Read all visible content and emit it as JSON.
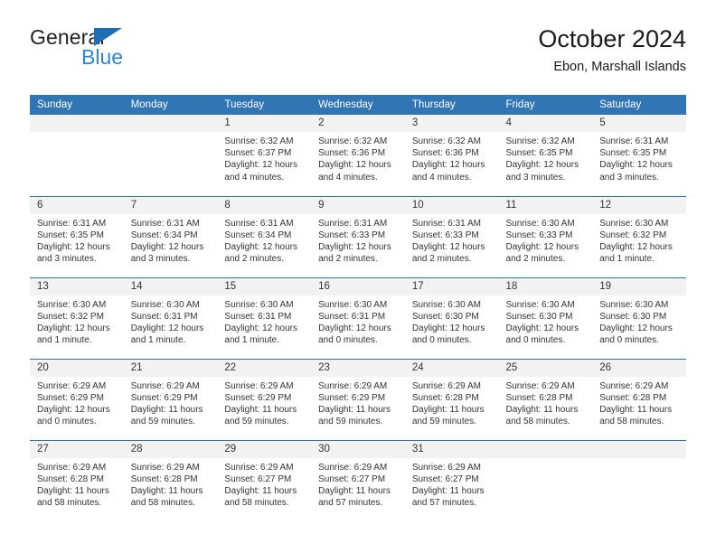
{
  "brand": {
    "word_one": "General",
    "word_two": "Blue",
    "triangle_color": "#1d6eb4",
    "blue_text_color": "#2f86d6"
  },
  "header": {
    "title": "October 2024",
    "subtitle": "Ebon, Marshall Islands"
  },
  "theme": {
    "header_blue": "#3175b4",
    "daynum_band": "#f2f2f2",
    "text": "#333333"
  },
  "weekdays": [
    "Sunday",
    "Monday",
    "Tuesday",
    "Wednesday",
    "Thursday",
    "Friday",
    "Saturday"
  ],
  "labels": {
    "sunrise": "Sunrise:",
    "sunset": "Sunset:",
    "daylight": "Daylight:"
  },
  "weeks": [
    [
      {
        "day": ""
      },
      {
        "day": ""
      },
      {
        "day": "1",
        "sunrise": "Sunrise: 6:32 AM",
        "sunset": "Sunset: 6:37 PM",
        "daylight_1": "Daylight: 12 hours",
        "daylight_2": "and 4 minutes."
      },
      {
        "day": "2",
        "sunrise": "Sunrise: 6:32 AM",
        "sunset": "Sunset: 6:36 PM",
        "daylight_1": "Daylight: 12 hours",
        "daylight_2": "and 4 minutes."
      },
      {
        "day": "3",
        "sunrise": "Sunrise: 6:32 AM",
        "sunset": "Sunset: 6:36 PM",
        "daylight_1": "Daylight: 12 hours",
        "daylight_2": "and 4 minutes."
      },
      {
        "day": "4",
        "sunrise": "Sunrise: 6:32 AM",
        "sunset": "Sunset: 6:35 PM",
        "daylight_1": "Daylight: 12 hours",
        "daylight_2": "and 3 minutes."
      },
      {
        "day": "5",
        "sunrise": "Sunrise: 6:31 AM",
        "sunset": "Sunset: 6:35 PM",
        "daylight_1": "Daylight: 12 hours",
        "daylight_2": "and 3 minutes."
      }
    ],
    [
      {
        "day": "6",
        "sunrise": "Sunrise: 6:31 AM",
        "sunset": "Sunset: 6:35 PM",
        "daylight_1": "Daylight: 12 hours",
        "daylight_2": "and 3 minutes."
      },
      {
        "day": "7",
        "sunrise": "Sunrise: 6:31 AM",
        "sunset": "Sunset: 6:34 PM",
        "daylight_1": "Daylight: 12 hours",
        "daylight_2": "and 3 minutes."
      },
      {
        "day": "8",
        "sunrise": "Sunrise: 6:31 AM",
        "sunset": "Sunset: 6:34 PM",
        "daylight_1": "Daylight: 12 hours",
        "daylight_2": "and 2 minutes."
      },
      {
        "day": "9",
        "sunrise": "Sunrise: 6:31 AM",
        "sunset": "Sunset: 6:33 PM",
        "daylight_1": "Daylight: 12 hours",
        "daylight_2": "and 2 minutes."
      },
      {
        "day": "10",
        "sunrise": "Sunrise: 6:31 AM",
        "sunset": "Sunset: 6:33 PM",
        "daylight_1": "Daylight: 12 hours",
        "daylight_2": "and 2 minutes."
      },
      {
        "day": "11",
        "sunrise": "Sunrise: 6:30 AM",
        "sunset": "Sunset: 6:33 PM",
        "daylight_1": "Daylight: 12 hours",
        "daylight_2": "and 2 minutes."
      },
      {
        "day": "12",
        "sunrise": "Sunrise: 6:30 AM",
        "sunset": "Sunset: 6:32 PM",
        "daylight_1": "Daylight: 12 hours",
        "daylight_2": "and 1 minute."
      }
    ],
    [
      {
        "day": "13",
        "sunrise": "Sunrise: 6:30 AM",
        "sunset": "Sunset: 6:32 PM",
        "daylight_1": "Daylight: 12 hours",
        "daylight_2": "and 1 minute."
      },
      {
        "day": "14",
        "sunrise": "Sunrise: 6:30 AM",
        "sunset": "Sunset: 6:31 PM",
        "daylight_1": "Daylight: 12 hours",
        "daylight_2": "and 1 minute."
      },
      {
        "day": "15",
        "sunrise": "Sunrise: 6:30 AM",
        "sunset": "Sunset: 6:31 PM",
        "daylight_1": "Daylight: 12 hours",
        "daylight_2": "and 1 minute."
      },
      {
        "day": "16",
        "sunrise": "Sunrise: 6:30 AM",
        "sunset": "Sunset: 6:31 PM",
        "daylight_1": "Daylight: 12 hours",
        "daylight_2": "and 0 minutes."
      },
      {
        "day": "17",
        "sunrise": "Sunrise: 6:30 AM",
        "sunset": "Sunset: 6:30 PM",
        "daylight_1": "Daylight: 12 hours",
        "daylight_2": "and 0 minutes."
      },
      {
        "day": "18",
        "sunrise": "Sunrise: 6:30 AM",
        "sunset": "Sunset: 6:30 PM",
        "daylight_1": "Daylight: 12 hours",
        "daylight_2": "and 0 minutes."
      },
      {
        "day": "19",
        "sunrise": "Sunrise: 6:30 AM",
        "sunset": "Sunset: 6:30 PM",
        "daylight_1": "Daylight: 12 hours",
        "daylight_2": "and 0 minutes."
      }
    ],
    [
      {
        "day": "20",
        "sunrise": "Sunrise: 6:29 AM",
        "sunset": "Sunset: 6:29 PM",
        "daylight_1": "Daylight: 12 hours",
        "daylight_2": "and 0 minutes."
      },
      {
        "day": "21",
        "sunrise": "Sunrise: 6:29 AM",
        "sunset": "Sunset: 6:29 PM",
        "daylight_1": "Daylight: 11 hours",
        "daylight_2": "and 59 minutes."
      },
      {
        "day": "22",
        "sunrise": "Sunrise: 6:29 AM",
        "sunset": "Sunset: 6:29 PM",
        "daylight_1": "Daylight: 11 hours",
        "daylight_2": "and 59 minutes."
      },
      {
        "day": "23",
        "sunrise": "Sunrise: 6:29 AM",
        "sunset": "Sunset: 6:29 PM",
        "daylight_1": "Daylight: 11 hours",
        "daylight_2": "and 59 minutes."
      },
      {
        "day": "24",
        "sunrise": "Sunrise: 6:29 AM",
        "sunset": "Sunset: 6:28 PM",
        "daylight_1": "Daylight: 11 hours",
        "daylight_2": "and 59 minutes."
      },
      {
        "day": "25",
        "sunrise": "Sunrise: 6:29 AM",
        "sunset": "Sunset: 6:28 PM",
        "daylight_1": "Daylight: 11 hours",
        "daylight_2": "and 58 minutes."
      },
      {
        "day": "26",
        "sunrise": "Sunrise: 6:29 AM",
        "sunset": "Sunset: 6:28 PM",
        "daylight_1": "Daylight: 11 hours",
        "daylight_2": "and 58 minutes."
      }
    ],
    [
      {
        "day": "27",
        "sunrise": "Sunrise: 6:29 AM",
        "sunset": "Sunset: 6:28 PM",
        "daylight_1": "Daylight: 11 hours",
        "daylight_2": "and 58 minutes."
      },
      {
        "day": "28",
        "sunrise": "Sunrise: 6:29 AM",
        "sunset": "Sunset: 6:28 PM",
        "daylight_1": "Daylight: 11 hours",
        "daylight_2": "and 58 minutes."
      },
      {
        "day": "29",
        "sunrise": "Sunrise: 6:29 AM",
        "sunset": "Sunset: 6:27 PM",
        "daylight_1": "Daylight: 11 hours",
        "daylight_2": "and 58 minutes."
      },
      {
        "day": "30",
        "sunrise": "Sunrise: 6:29 AM",
        "sunset": "Sunset: 6:27 PM",
        "daylight_1": "Daylight: 11 hours",
        "daylight_2": "and 57 minutes."
      },
      {
        "day": "31",
        "sunrise": "Sunrise: 6:29 AM",
        "sunset": "Sunset: 6:27 PM",
        "daylight_1": "Daylight: 11 hours",
        "daylight_2": "and 57 minutes."
      },
      {
        "day": ""
      },
      {
        "day": ""
      }
    ]
  ]
}
